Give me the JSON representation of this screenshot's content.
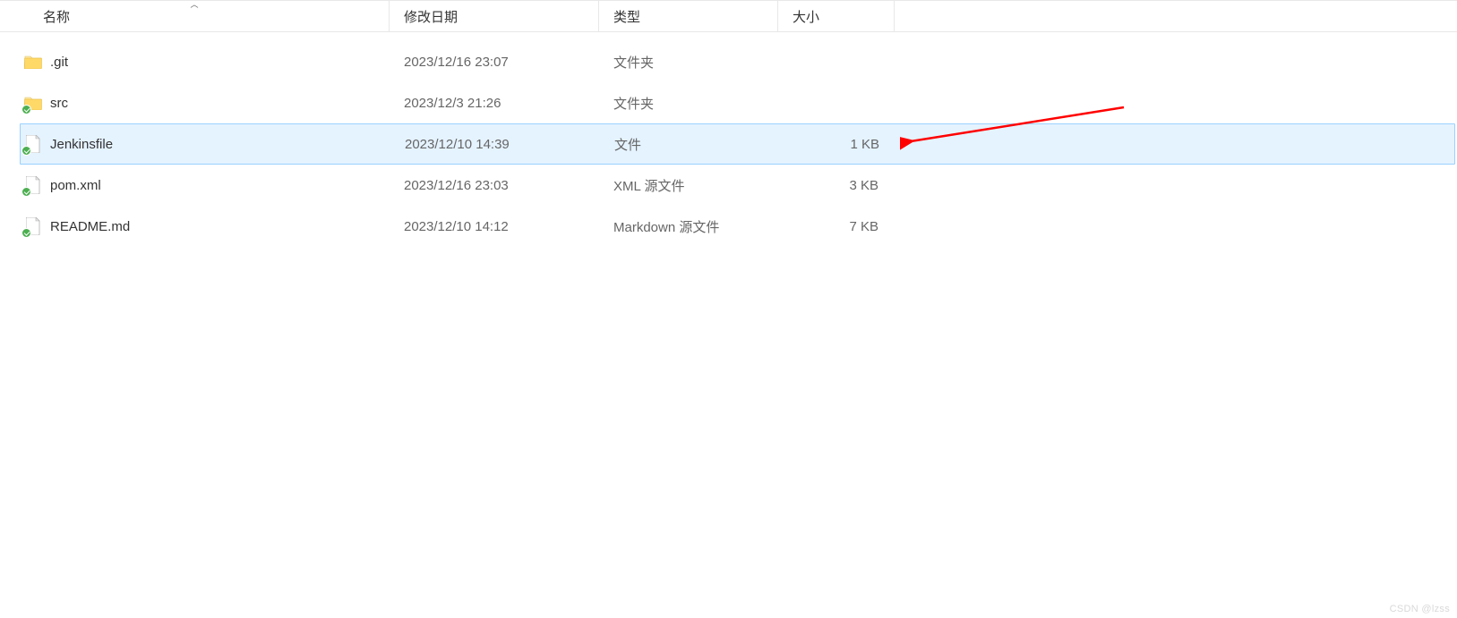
{
  "columns": {
    "name": "名称",
    "date": "修改日期",
    "type": "类型",
    "size": "大小"
  },
  "files": [
    {
      "icon": "folder",
      "name": ".git",
      "date": "2023/12/16 23:07",
      "type": "文件夹",
      "size": "",
      "selected": false
    },
    {
      "icon": "folder-badge",
      "name": "src",
      "date": "2023/12/3 21:26",
      "type": "文件夹",
      "size": "",
      "selected": false
    },
    {
      "icon": "file-badge",
      "name": "Jenkinsfile",
      "date": "2023/12/10 14:39",
      "type": "文件",
      "size": "1 KB",
      "selected": true
    },
    {
      "icon": "file-badge",
      "name": "pom.xml",
      "date": "2023/12/16 23:03",
      "type": "XML 源文件",
      "size": "3 KB",
      "selected": false
    },
    {
      "icon": "file-badge",
      "name": "README.md",
      "date": "2023/12/10 14:12",
      "type": "Markdown 源文件",
      "size": "7 KB",
      "selected": false
    }
  ],
  "watermark": "CSDN @lzss"
}
